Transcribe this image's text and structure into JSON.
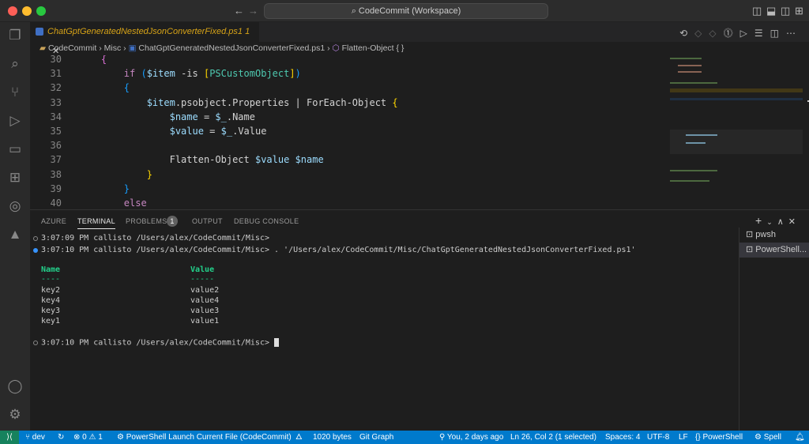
{
  "window": {
    "title": "CodeCommit (Workspace)"
  },
  "tab": {
    "label": "ChatGptGeneratedNestedJsonConverterFixed.ps1",
    "badge": "1"
  },
  "breadcrumb": {
    "items": [
      "CodeCommit",
      "Misc",
      "ChatGptGeneratedNestedJsonConverterFixed.ps1",
      "Flatten-Object { }"
    ]
  },
  "editor": {
    "line_numbers": [
      "30",
      "31",
      "32",
      "33",
      "34",
      "35",
      "36",
      "37",
      "38",
      "39",
      "40"
    ]
  },
  "panel": {
    "tabs": [
      "AZURE",
      "TERMINAL",
      "PROBLEMS",
      "OUTPUT",
      "DEBUG CONSOLE"
    ],
    "problems_count": "1",
    "active_tab": "TERMINAL"
  },
  "terminal": {
    "lines": [
      "3:07:09 PM callisto /Users/alex/CodeCommit/Misc>",
      "3:07:10 PM callisto /Users/alex/CodeCommit/Misc> . '/Users/alex/CodeCommit/Misc/ChatGptGeneratedNestedJsonConverterFixed.ps1'"
    ],
    "table_headers": [
      "Name",
      "Value"
    ],
    "table_underlines": [
      "----",
      "-----"
    ],
    "rows": [
      [
        "key2",
        "value2"
      ],
      [
        "key4",
        "value4"
      ],
      [
        "key3",
        "value3"
      ],
      [
        "key1",
        "value1"
      ]
    ],
    "prompt": "3:07:10 PM callisto /Users/alex/CodeCommit/Misc> ",
    "instances": [
      "pwsh",
      "PowerShell..."
    ]
  },
  "status": {
    "branch": "dev",
    "errors": "0",
    "warnings": "1",
    "launch": "PowerShell Launch Current File (CodeCommit)",
    "size": "1020 bytes",
    "git_graph": "Git Graph",
    "blame": "You, 2 days ago",
    "position": "Ln 26, Col 2 (1 selected)",
    "spaces": "Spaces: 4",
    "encoding": "UTF-8",
    "eol": "LF",
    "language": "PowerShell",
    "spell": "Spell"
  },
  "colors": {
    "accent": "#007acc",
    "tab_modified": "#d7a317",
    "terminal_header": "#23d18b"
  }
}
